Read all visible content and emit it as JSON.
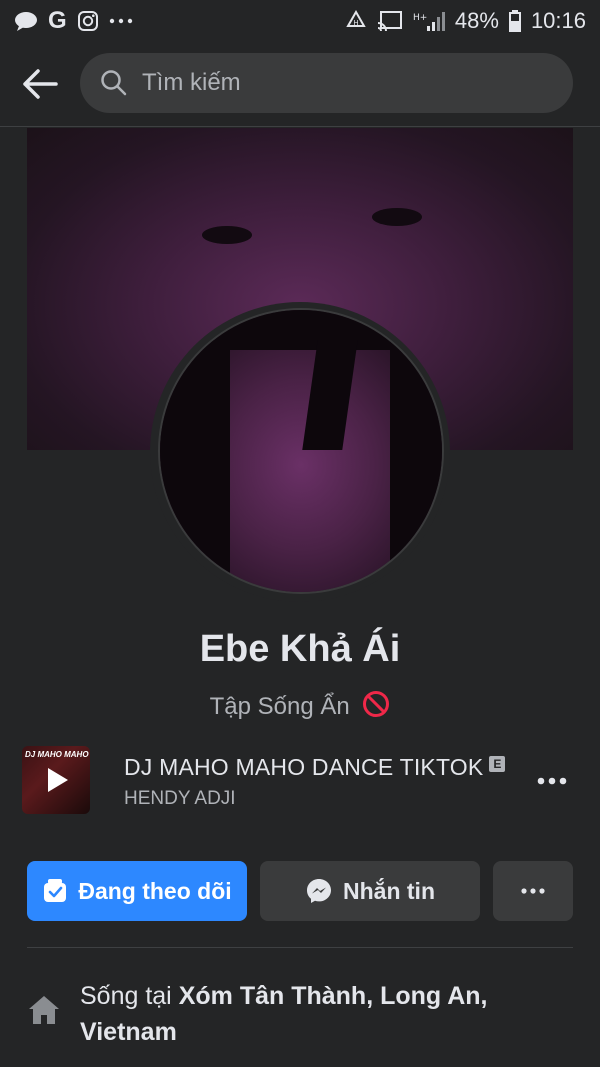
{
  "status_bar": {
    "battery": "48%",
    "time": "10:16",
    "icons": [
      "chat-bubble-icon",
      "google-icon",
      "instagram-icon",
      "more-dots-icon",
      "recycle-icon",
      "cast-icon",
      "signal-icon",
      "battery-icon"
    ]
  },
  "header": {
    "search_placeholder": "Tìm kiếm"
  },
  "profile": {
    "name": "Ebe Khả Ái",
    "bio": "Tập Sống Ẩn"
  },
  "music": {
    "art_label": "DJ MAHO MAHO",
    "title": "DJ MAHO MAHO DANCE TIKTOK",
    "explicit": "E",
    "artist": "HENDY ADJI"
  },
  "actions": {
    "follow_label": "Đang theo dõi",
    "message_label": "Nhắn tin"
  },
  "details": {
    "lives_prefix": "Sống tại",
    "lives_location": "Xóm Tân Thành, Long An, Vietnam"
  },
  "colors": {
    "background": "#242526",
    "accent": "#2d88ff",
    "button_secondary": "#3a3b3c"
  }
}
